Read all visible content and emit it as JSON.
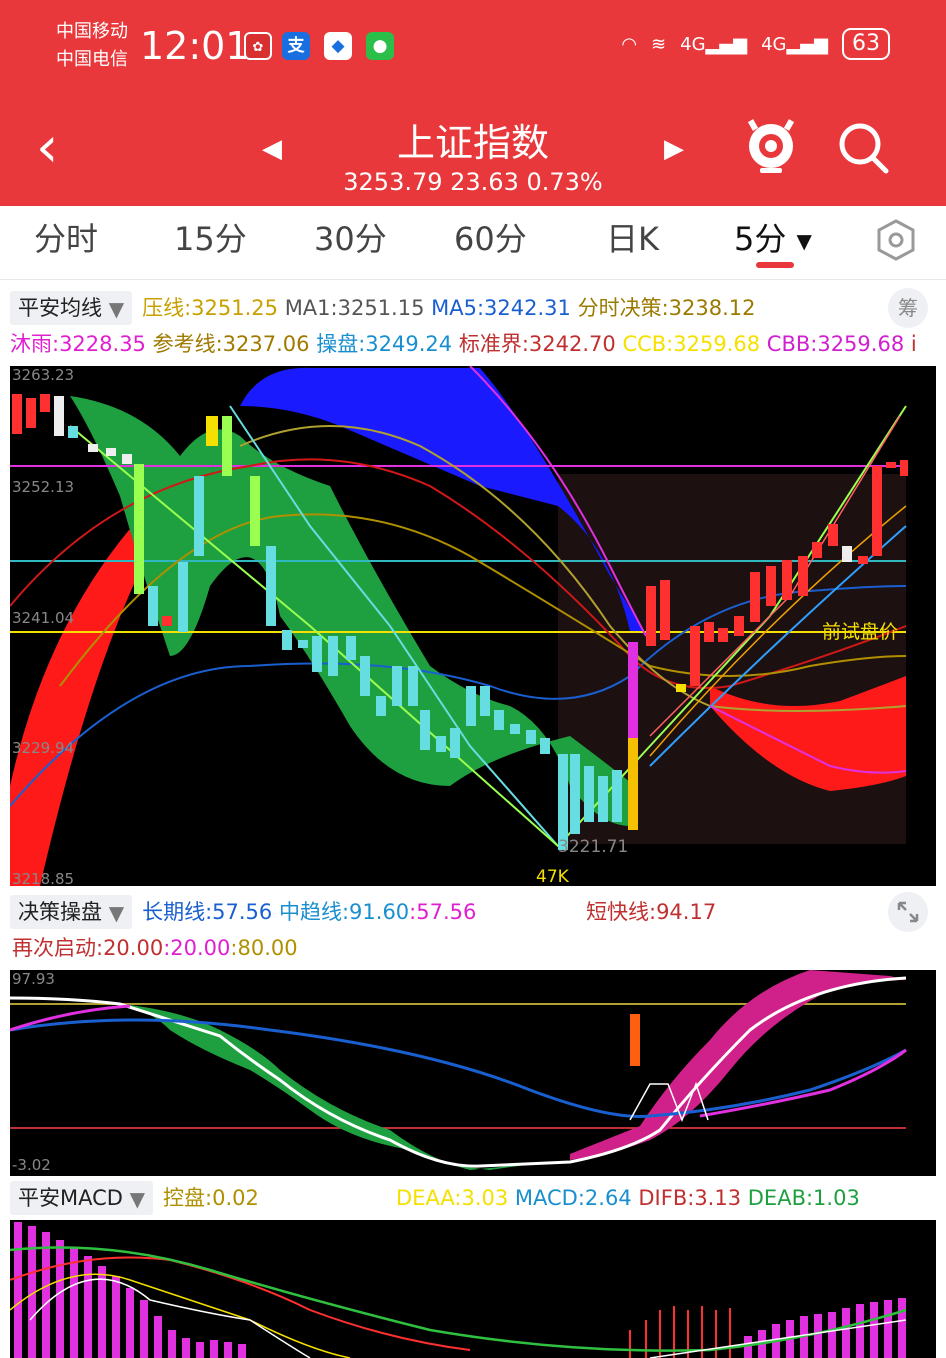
{
  "status_bar": {
    "carrier1": "中国移动",
    "carrier2": "中国电信",
    "time": "12:01",
    "network1": "4G",
    "network2": "4G",
    "battery": "63"
  },
  "header": {
    "title": "上证指数",
    "quote": "3253.79 23.63 0.73%",
    "bg_color": "#e8383b"
  },
  "tabs": [
    {
      "label": "分时"
    },
    {
      "label": "15分"
    },
    {
      "label": "30分"
    },
    {
      "label": "60分"
    },
    {
      "label": "日K"
    },
    {
      "label": "5分",
      "active": true
    }
  ],
  "main_indicators": {
    "selector": "平安均线",
    "pressure": "压线:3251.25",
    "ma1": "MA1:3251.15",
    "ma5": "MA5:3242.31",
    "decision": "分时决策:3238.12",
    "formula_btn": "筹",
    "muyu": "沐雨:3228.35",
    "ref_line": "参考线:3237.06",
    "operate": "操盘:3249.24",
    "std_bound": "标准界:3242.70",
    "ccb": "CCB:3259.68",
    "cbb": "CBB:3259.68",
    "trailing": "i"
  },
  "main_chart": {
    "y_labels": [
      "3263.23",
      "3252.13",
      "3241.04",
      "3229.94",
      "3218.85"
    ],
    "low_label": "3221.71",
    "count_label": "47K",
    "annotation": "前试盘价"
  },
  "decision_panel": {
    "selector": "决策操盘",
    "long_line": "长期线:57.56",
    "mid_trend": "中趋线:91.60",
    "mid_trend_b": ":57.56",
    "short_fast": "短快线:94.17",
    "restart": "再次启动:20.00",
    "v2": ":20.00",
    "v3": ":80.00",
    "y_top": "97.93",
    "y_bottom": "-3.02"
  },
  "macd_panel": {
    "selector": "平安MACD",
    "control": "控盘:0.02",
    "deaa": "DEAA:3.03",
    "macd": "MACD:2.64",
    "difb": "DIFB:3.13",
    "deab": "DEAB:1.03"
  },
  "colors": {
    "up": "#ff3030",
    "down": "#66dde0",
    "green_band": "#1fa040",
    "blue_band": "#1a1aff",
    "magenta": "#d020b0"
  }
}
